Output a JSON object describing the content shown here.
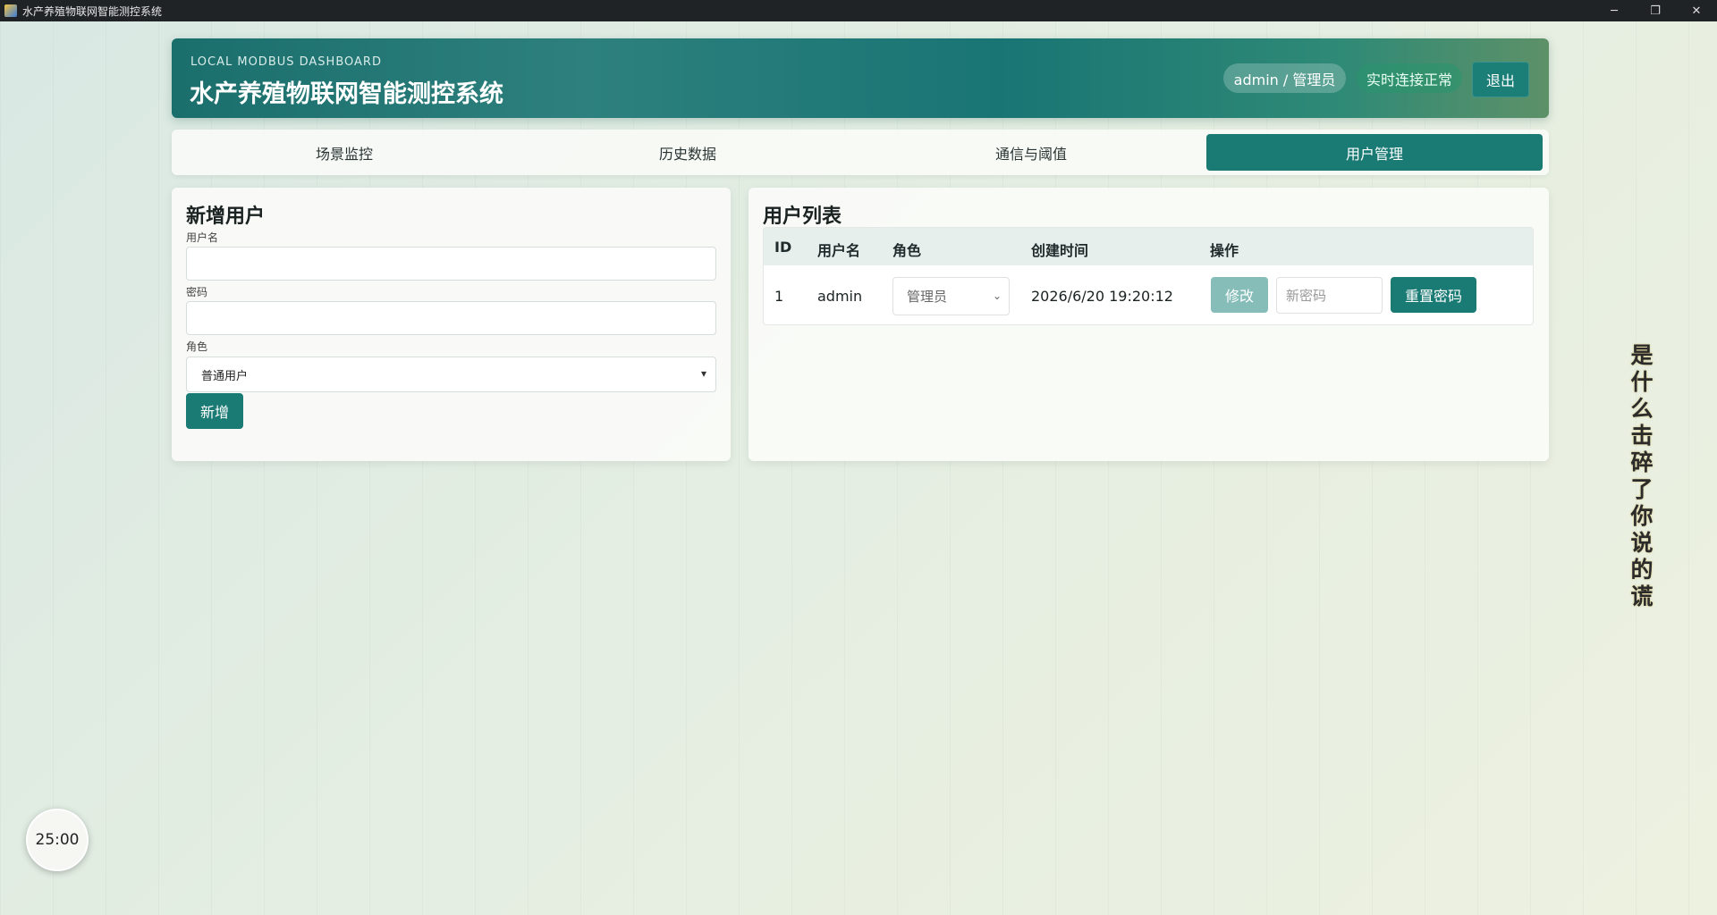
{
  "window": {
    "title": "水产养殖物联网智能测控系统",
    "minimize": "─",
    "maximize": "❐",
    "close": "✕"
  },
  "header": {
    "eyebrow": "LOCAL MODBUS DASHBOARD",
    "title": "水产养殖物联网智能测控系统",
    "user_chip": "admin / 管理员",
    "status_chip": "实时连接正常",
    "logout": "退出"
  },
  "tabs": [
    {
      "label": "场景监控",
      "active": false
    },
    {
      "label": "历史数据",
      "active": false
    },
    {
      "label": "通信与阈值",
      "active": false
    },
    {
      "label": "用户管理",
      "active": true
    }
  ],
  "add_user": {
    "title": "新增用户",
    "username_label": "用户名",
    "password_label": "密码",
    "role_label": "角色",
    "role_value": "普通用户",
    "submit": "新增"
  },
  "user_list": {
    "title": "用户列表",
    "columns": [
      "ID",
      "用户名",
      "角色",
      "创建时间",
      "操作"
    ],
    "rows": [
      {
        "id": "1",
        "username": "admin",
        "role": "管理员",
        "created": "2026/6/20 19:20:12",
        "edit": "修改",
        "new_password_placeholder": "新密码",
        "reset": "重置密码"
      }
    ]
  },
  "side_text": "是什么击碎了你说的谎",
  "timer": "25:00",
  "colors": {
    "accent": "#1a7a74",
    "accent_disabled": "#86bdb8",
    "header_gradient_start": "#1a6e6c",
    "header_gradient_end": "#5d9168"
  }
}
